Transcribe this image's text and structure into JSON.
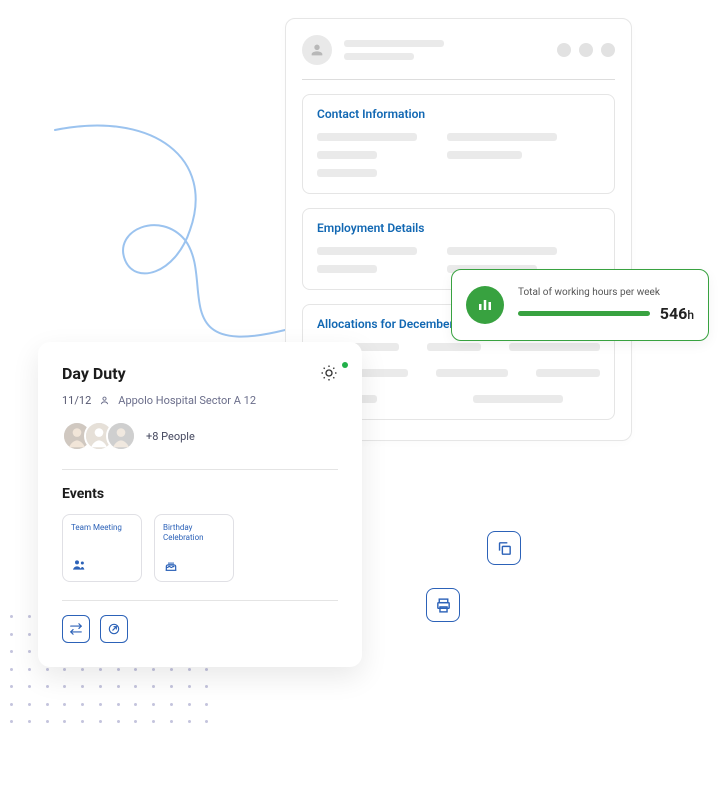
{
  "profile": {
    "sections": {
      "contact": {
        "title": "Contact Information"
      },
      "employment": {
        "title": "Employment Details"
      },
      "allocations": {
        "title": "Allocations for December"
      }
    }
  },
  "stat": {
    "label": "Total of working hours per week",
    "value": "546",
    "unit": "h"
  },
  "duty": {
    "title": "Day Duty",
    "date": "11/12",
    "location": "Appolo Hospital Sector A 12",
    "more_people": "+8 People",
    "events_heading": "Events",
    "events": [
      {
        "label": "Team Meeting"
      },
      {
        "label": "Birthday Celebration"
      }
    ]
  }
}
